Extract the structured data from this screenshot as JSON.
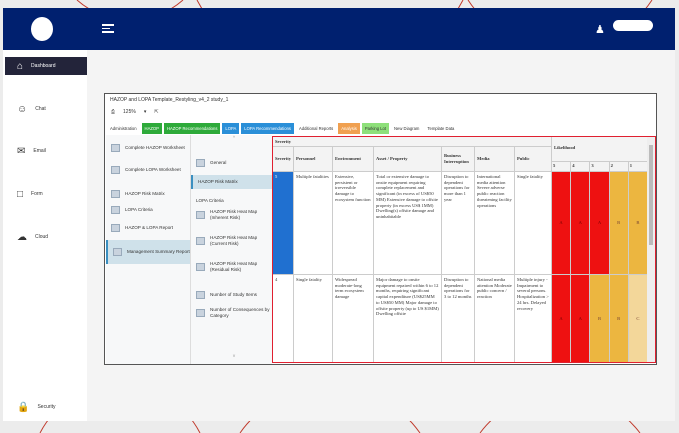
{
  "header": {
    "user_icon": "user-icon"
  },
  "sidebar": {
    "items": [
      {
        "label": "Dashboard",
        "icon": "home-icon"
      },
      {
        "label": "Chat",
        "icon": "chat-icon"
      },
      {
        "label": "Email",
        "icon": "email-icon"
      },
      {
        "label": "Form",
        "icon": "form-icon"
      },
      {
        "label": "Cloud",
        "icon": "cloud-icon"
      },
      {
        "label": "Security",
        "icon": "lock-icon"
      }
    ]
  },
  "window": {
    "title": "HAZOP and LOPA Template_Restyling_v4_2 study_1",
    "zoom": "125%",
    "tabs": [
      {
        "label": "Administration",
        "color": "#ffffff"
      },
      {
        "label": "HAZOP",
        "color": "#2eaa3a"
      },
      {
        "label": "HAZOP Recommendations",
        "color": "#2eaa3a"
      },
      {
        "label": "LOPA",
        "color": "#2a8fd8"
      },
      {
        "label": "LOPA Recommendations",
        "color": "#2a8fd8"
      },
      {
        "label": "Additional Reports",
        "color": "#ffffff"
      },
      {
        "label": "Analysis",
        "color": "#f0a050"
      },
      {
        "label": "Parking Lot",
        "color": "#8ee07a"
      },
      {
        "label": "New Diagram",
        "color": "#ffffff"
      },
      {
        "label": "Template Data",
        "color": "#ffffff"
      }
    ],
    "left_items": [
      "Complete HAZOP Worksheet",
      "Complete LOPA Worksheet",
      "HAZOP Risk Matrix",
      "LOPA Criteria",
      "HAZOP & LOPA Report",
      "Management Summary Report"
    ],
    "mid_items": [
      "General",
      "HAZOP Risk Matrix",
      "LOPA Criteria",
      "HAZOP Risk Heat Map (Inherent Risk)",
      "HAZOP Risk Heat Map (Current Risk)",
      "HAZOP Risk Heat Map (Residual Risk)",
      "Number of Study Items",
      "Number of Consequences by Category"
    ]
  },
  "table": {
    "group": "Severity",
    "likelihood": "Likelihood",
    "columns": [
      "Severity",
      "Personnel",
      "Environment",
      "Asset / Property",
      "Business Interruption",
      "Media",
      "Public"
    ],
    "likelihood_cols": [
      "5",
      "4",
      "3",
      "2",
      "1"
    ],
    "rows": [
      {
        "sev": "5",
        "cells": [
          "Multiple fatalities",
          "Extensive, persistent or irreversible damage to ecosystem function",
          "Total or extensive damage to onsite equipment requiring complete replacement and significant (in excess of US$50 MM) Extensive damage to offsite property (in excess US$ 1MM) Dwelling(s) offsite damage and uninhabitable",
          "Disruption to dependent operations for more than 1 year",
          "International media attention Severe adverse public reaction threatening facility operations",
          "Single fatality"
        ],
        "lk": [
          "A",
          "A",
          "A",
          "B",
          "B"
        ]
      },
      {
        "sev": "4",
        "cells": [
          "Single fatality",
          "Widespread moderate-long term ecosystem damage",
          "Major damage to onsite equipment repaired within 6 to 12 months, requiring significant capital expenditure (US$25MM to US$50 MM) Major damage to offsite property (up to US $1MM) Dwelling offsite",
          "Disruption to dependent operations for 3 to 12 months",
          "National media attention Moderate public concern / reaction",
          "Multiple injury - Impairment to several persons. Hospitalization > 24 hrs. Delayed recovery"
        ],
        "lk": [
          "A",
          "A",
          "B",
          "B",
          "C"
        ]
      }
    ]
  }
}
